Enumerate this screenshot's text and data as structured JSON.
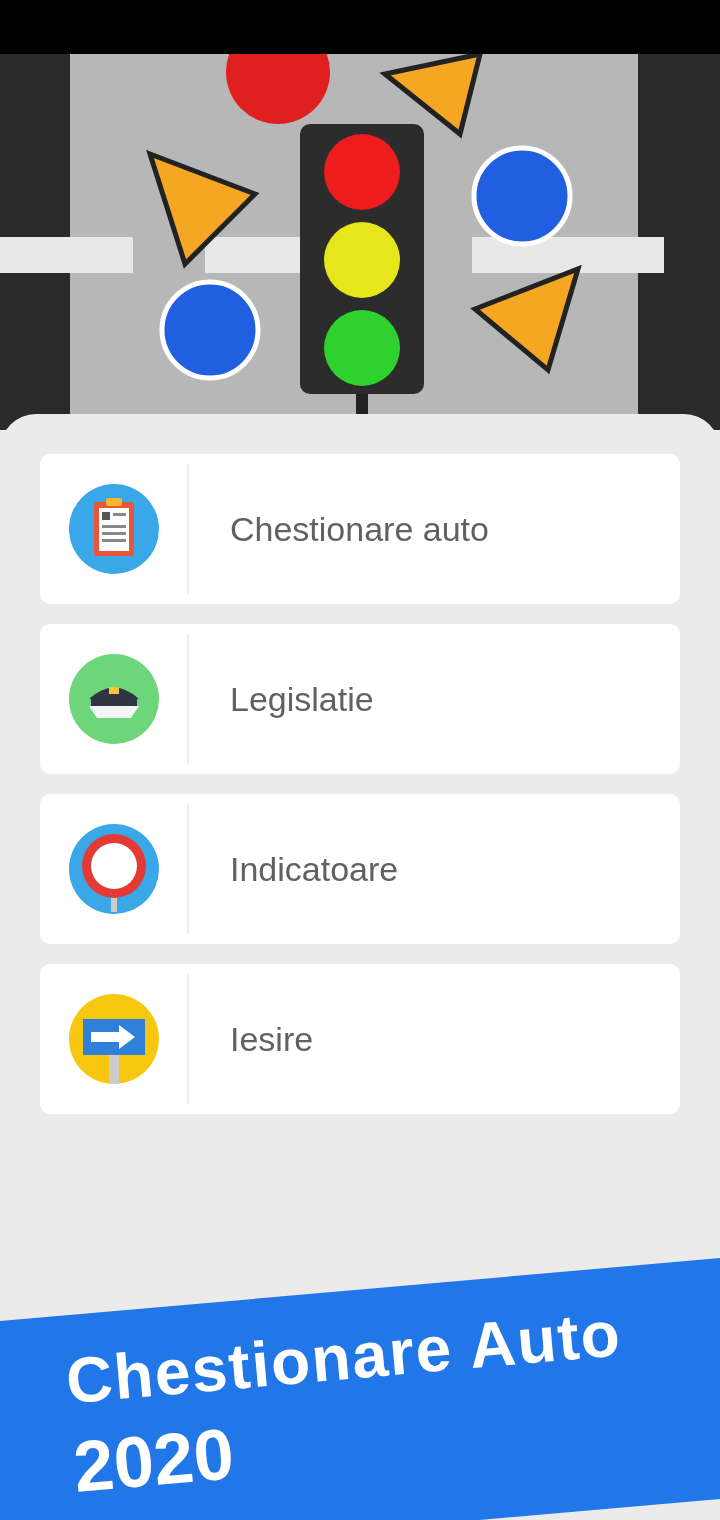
{
  "menu": [
    {
      "kind": "quiz",
      "label": "Chestionare auto"
    },
    {
      "kind": "law",
      "label": "Legislatie"
    },
    {
      "kind": "signs",
      "label": "Indicatoare"
    },
    {
      "kind": "exit",
      "label": "Iesire"
    }
  ],
  "banner": {
    "lines": [
      "Chestionare Auto",
      "2020"
    ]
  }
}
